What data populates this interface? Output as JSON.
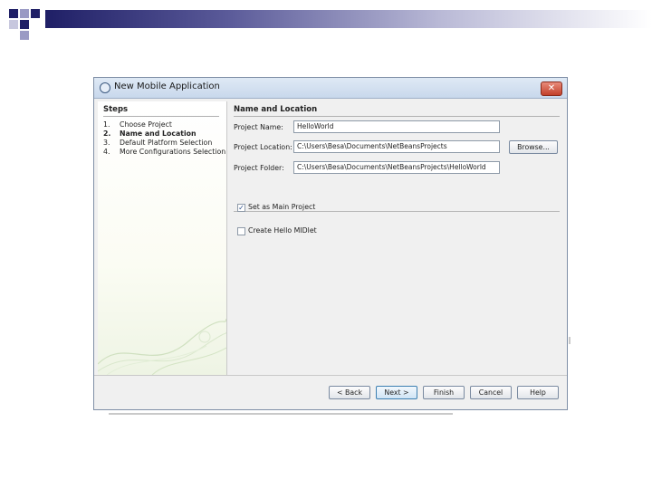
{
  "dialog": {
    "title": "New Mobile Application",
    "close_icon": "close-icon"
  },
  "steps": {
    "title": "Steps",
    "items": [
      {
        "num": "1.",
        "label": "Choose Project"
      },
      {
        "num": "2.",
        "label": "Name and Location"
      },
      {
        "num": "3.",
        "label": "Default Platform Selection"
      },
      {
        "num": "4.",
        "label": "More Configurations Selection"
      }
    ]
  },
  "section": {
    "title": "Name and Location",
    "project_name_label": "Project Name:",
    "project_name_value": "HelloWorld",
    "project_location_label": "Project Location:",
    "project_location_value": "C:\\Users\\Besa\\Documents\\NetBeansProjects",
    "browse_label": "Browse...",
    "project_folder_label": "Project Folder:",
    "project_folder_value": "C:\\Users\\Besa\\Documents\\NetBeansProjects\\HelloWorld",
    "main_project_label": "Set as Main Project",
    "main_project_checked": true,
    "hello_midlet_label": "Create Hello MIDlet",
    "hello_midlet_checked": false
  },
  "buttons": {
    "back": "< Back",
    "next": "Next >",
    "finish": "Finish",
    "cancel": "Cancel",
    "help": "Help"
  },
  "colors": {
    "slide_accent": "#1f1f66",
    "titlebar": "#c8d8ec",
    "focus_border": "#3c7fb1"
  }
}
